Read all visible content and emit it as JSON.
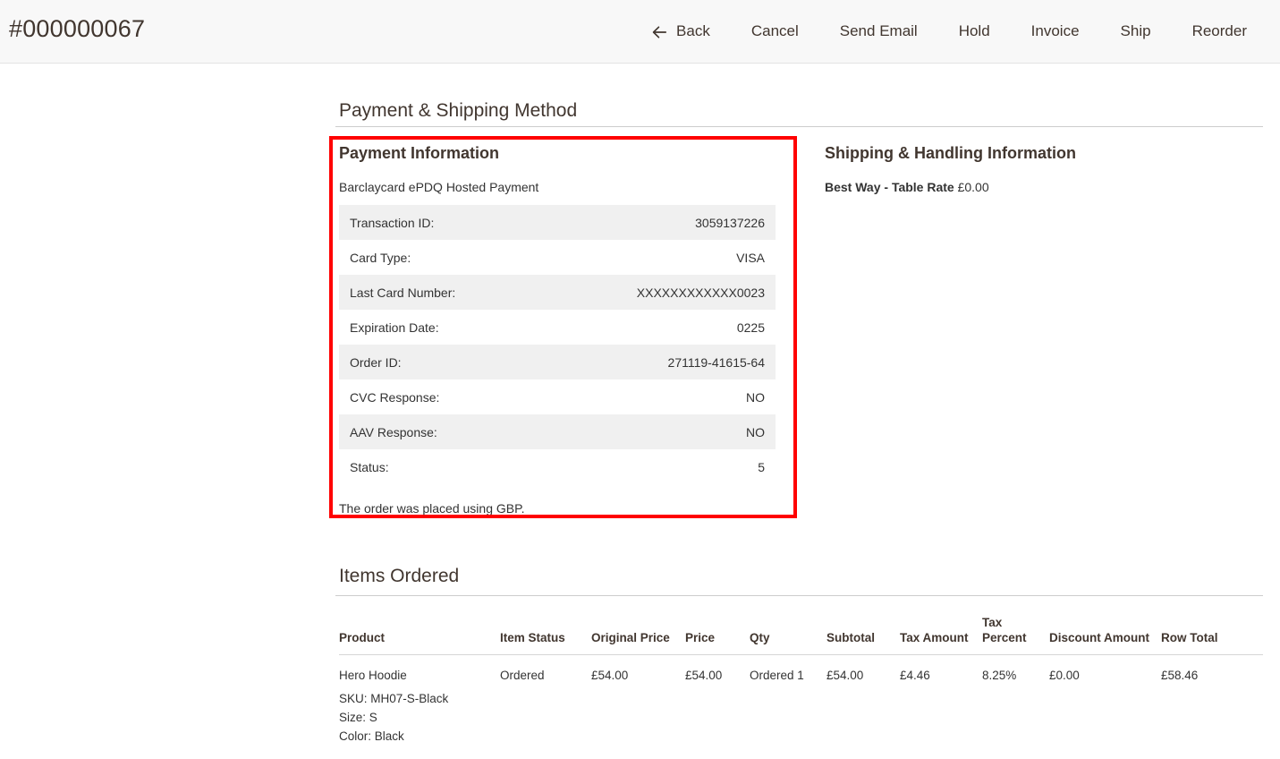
{
  "header": {
    "order_increment_id": "#000000067",
    "actions": [
      {
        "label": "Back",
        "icon": "arrow-left-icon"
      },
      {
        "label": "Cancel",
        "icon": ""
      },
      {
        "label": "Send Email",
        "icon": ""
      },
      {
        "label": "Hold",
        "icon": ""
      },
      {
        "label": "Invoice",
        "icon": ""
      },
      {
        "label": "Ship",
        "icon": ""
      },
      {
        "label": "Reorder",
        "icon": ""
      }
    ]
  },
  "payment_shipping": {
    "section_title": "Payment & Shipping Method",
    "highlight_color": "#ff0000",
    "payment": {
      "heading": "Payment Information",
      "method": "Barclaycard ePDQ Hosted Payment",
      "rows": [
        {
          "label": "Transaction ID:",
          "value": "3059137226"
        },
        {
          "label": "Card Type:",
          "value": "VISA"
        },
        {
          "label": "Last Card Number:",
          "value": "XXXXXXXXXXXX0023"
        },
        {
          "label": "Expiration Date:",
          "value": "0225"
        },
        {
          "label": "Order ID:",
          "value": "271119-41615-64"
        },
        {
          "label": "CVC Response:",
          "value": "NO"
        },
        {
          "label": "AAV Response:",
          "value": "NO"
        },
        {
          "label": "Status:",
          "value": "5"
        }
      ],
      "currency_note": "The order was placed using GBP."
    },
    "shipping": {
      "heading": "Shipping & Handling Information",
      "method": "Best Way - Table Rate",
      "price": "£0.00"
    }
  },
  "items_ordered": {
    "section_title": "Items Ordered",
    "columns": [
      "Product",
      "Item Status",
      "Original Price",
      "Price",
      "Qty",
      "Subtotal",
      "Tax Amount",
      "Tax Percent",
      "Discount Amount",
      "Row Total"
    ],
    "rows": [
      {
        "product_name": "Hero Hoodie",
        "sku": "SKU: MH07-S-Black",
        "options": [
          "Size: S",
          "Color: Black"
        ],
        "item_status": "Ordered",
        "original_price": "£54.00",
        "price": "£54.00",
        "qty": "Ordered 1",
        "subtotal": "£54.00",
        "tax_amount": "£4.46",
        "tax_percent": "8.25%",
        "discount_amount": "£0.00",
        "row_total": "£58.46"
      }
    ]
  }
}
